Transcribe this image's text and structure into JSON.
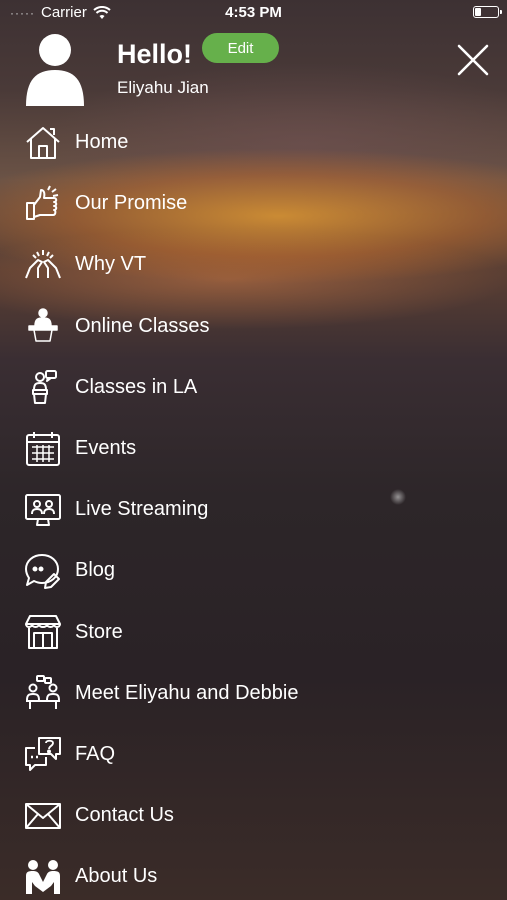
{
  "status_bar": {
    "signal": "·····",
    "carrier": "Carrier",
    "time": "4:53 PM"
  },
  "header": {
    "greeting": "Hello!",
    "edit_label": "Edit",
    "username": "Eliyahu Jian"
  },
  "menu": {
    "items": [
      {
        "label": "Home",
        "icon": "home-icon"
      },
      {
        "label": "Our Promise",
        "icon": "thumbs-up-icon"
      },
      {
        "label": "Why VT",
        "icon": "high-five-icon"
      },
      {
        "label": "Online Classes",
        "icon": "lecturer-icon"
      },
      {
        "label": "Classes in LA",
        "icon": "speaker-podium-icon"
      },
      {
        "label": "Events",
        "icon": "calendar-icon"
      },
      {
        "label": "Live Streaming",
        "icon": "video-call-icon"
      },
      {
        "label": "Blog",
        "icon": "chat-bubble-pen-icon"
      },
      {
        "label": "Store",
        "icon": "storefront-icon"
      },
      {
        "label": "Meet Eliyahu and Debbie",
        "icon": "meeting-icon"
      },
      {
        "label": "FAQ",
        "icon": "question-chat-icon"
      },
      {
        "label": "Contact Us",
        "icon": "envelope-icon"
      },
      {
        "label": "About Us",
        "icon": "people-icon"
      }
    ]
  },
  "colors": {
    "accent": "#66b04b",
    "text": "#ffffff"
  }
}
